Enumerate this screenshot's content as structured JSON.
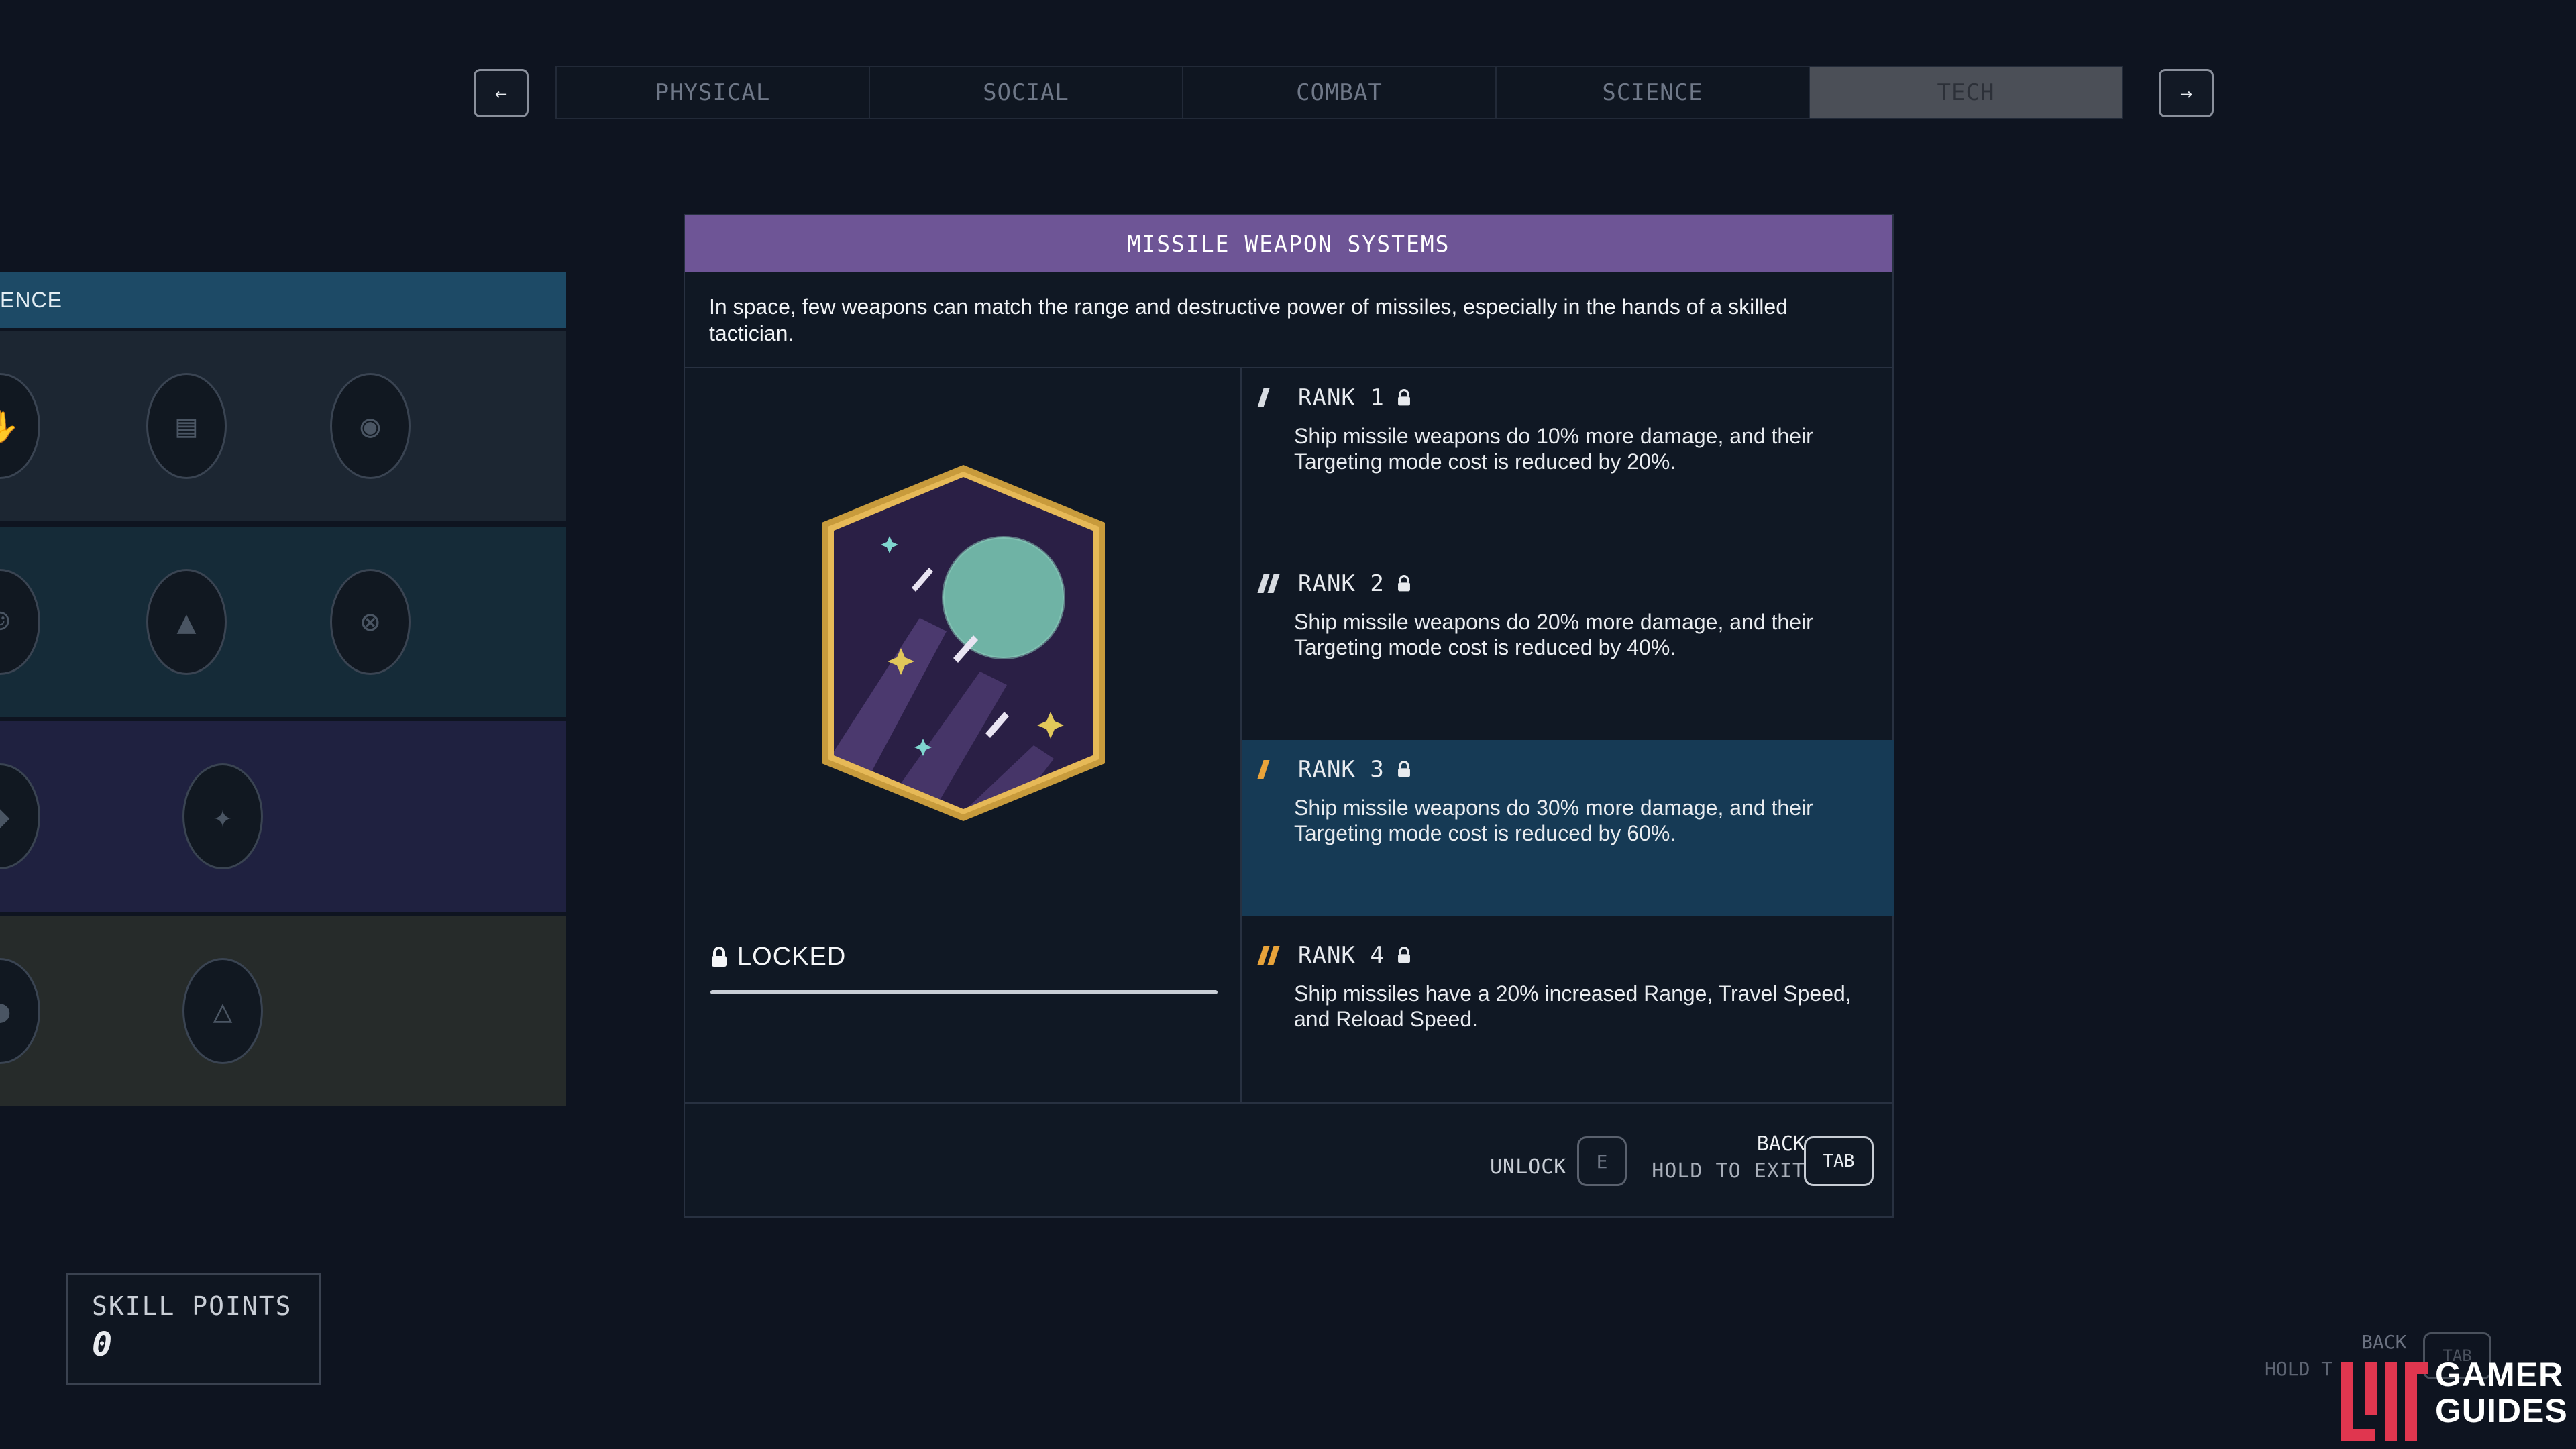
{
  "nav": {
    "prev_icon": "←",
    "next_icon": "→",
    "tabs": [
      {
        "label": "PHYSICAL",
        "active": false
      },
      {
        "label": "SOCIAL",
        "active": false
      },
      {
        "label": "COMBAT",
        "active": false
      },
      {
        "label": "SCIENCE",
        "active": false
      },
      {
        "label": "TECH",
        "active": true
      }
    ]
  },
  "left_tree": {
    "header": "ENCE"
  },
  "skill": {
    "title": "MISSILE WEAPON SYSTEMS",
    "description": "In space, few weapons can match the range and destructive power of missiles, especially in the hands of a skilled tactician.",
    "status": "LOCKED",
    "ranks": [
      {
        "label": "RANK 1",
        "text": "Ship missile weapons do 10% more damage, and their Targeting mode cost is reduced by 20%.",
        "selected": false
      },
      {
        "label": "RANK 2",
        "text": "Ship missile weapons do 20% more damage, and their Targeting mode cost is reduced by 40%.",
        "selected": false
      },
      {
        "label": "RANK 3",
        "text": "Ship missile weapons do 30% more damage, and their Targeting mode cost is reduced by 60%.",
        "selected": true
      },
      {
        "label": "RANK 4",
        "text": "Ship missiles have a 20% increased Range, Travel Speed, and Reload Speed.",
        "selected": false
      }
    ]
  },
  "footer": {
    "unlock_label": "UNLOCK",
    "unlock_key": "E",
    "back_label": "BACK",
    "hold_label": "HOLD TO EXIT",
    "back_key": "TAB"
  },
  "skill_points": {
    "label": "SKILL POINTS",
    "value": "0"
  },
  "ghost_hint": {
    "back": "BACK",
    "hold": "HOLD T",
    "key": "TAB"
  },
  "watermark": {
    "line1": "GAMER",
    "line2": "GUIDES"
  },
  "colors": {
    "accent_purple": "#6e5596",
    "selected_rank": "#163a55",
    "rank_gold": "#e8a33a"
  }
}
